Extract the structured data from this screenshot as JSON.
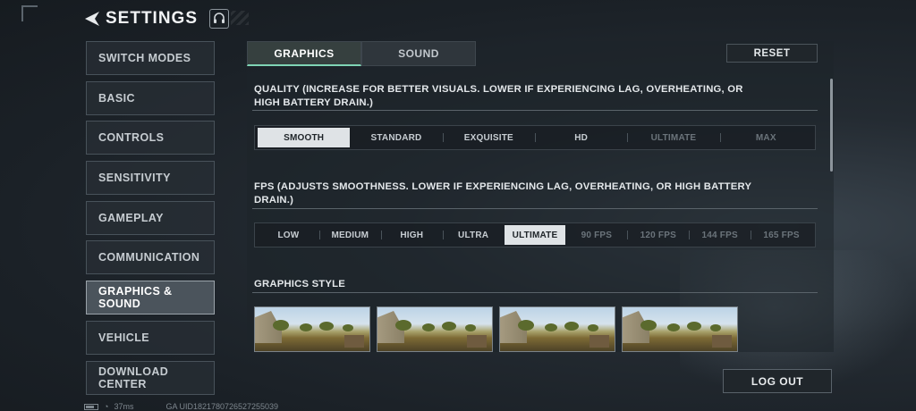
{
  "header": {
    "title": "SETTINGS"
  },
  "sidebar": {
    "items": [
      {
        "label": "SWITCH MODES"
      },
      {
        "label": "BASIC"
      },
      {
        "label": "CONTROLS"
      },
      {
        "label": "SENSITIVITY"
      },
      {
        "label": "GAMEPLAY"
      },
      {
        "label": "COMMUNICATION"
      },
      {
        "label": "GRAPHICS & SOUND",
        "active": true
      },
      {
        "label": "VEHICLE"
      },
      {
        "label": "DOWNLOAD CENTER"
      }
    ]
  },
  "tabs": [
    {
      "label": "GRAPHICS",
      "active": true
    },
    {
      "label": "SOUND"
    }
  ],
  "reset_label": "RESET",
  "quality": {
    "title": "QUALITY (INCREASE FOR BETTER VISUALS. LOWER IF EXPERIENCING LAG, OVERHEATING, OR HIGH BATTERY DRAIN.)",
    "options": [
      "SMOOTH",
      "STANDARD",
      "EXQUISITE",
      "HD",
      "ULTIMATE",
      "MAX"
    ],
    "selected": "SMOOTH",
    "disabled": [
      "ULTIMATE",
      "MAX"
    ]
  },
  "fps": {
    "title": "FPS (ADJUSTS SMOOTHNESS. LOWER IF EXPERIENCING LAG, OVERHEATING, OR HIGH BATTERY DRAIN.)",
    "options": [
      "LOW",
      "MEDIUM",
      "HIGH",
      "ULTRA",
      "ULTIMATE",
      "90 FPS",
      "120 FPS",
      "144 FPS",
      "165 FPS"
    ],
    "selected": "ULTIMATE",
    "disabled": [
      "90 FPS",
      "120 FPS",
      "144 FPS",
      "165 FPS"
    ]
  },
  "graphics_style": {
    "title": "GRAPHICS STYLE",
    "thumbnail_count": 4
  },
  "logout_label": "LOG OUT",
  "status": {
    "ping": "37ms",
    "uid": "GA UID1821780726527255039"
  },
  "colors": {
    "accent": "#7fd4b5",
    "selected_bg": "#dfe3e6"
  }
}
